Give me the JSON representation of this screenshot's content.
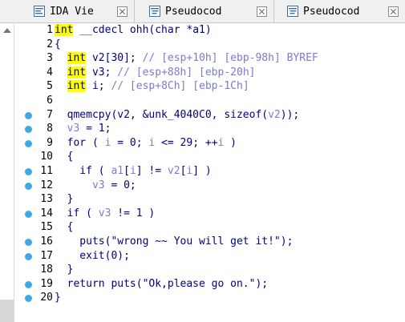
{
  "tabs": [
    {
      "label": "IDA Vie",
      "icon": "ida-view-icon"
    },
    {
      "label": "Pseudocod",
      "icon": "pseudocode-icon"
    },
    {
      "label": "Pseudocod",
      "icon": "pseudocode-icon"
    }
  ],
  "lines": [
    {
      "num": "1",
      "bp": false,
      "parts": [
        [
          "kw",
          "int"
        ],
        [
          "t",
          " __cdecl ohh(char *a1)"
        ]
      ]
    },
    {
      "num": "2",
      "bp": false,
      "parts": [
        [
          "t",
          "{"
        ]
      ]
    },
    {
      "num": "3",
      "bp": false,
      "parts": [
        [
          "t",
          "  "
        ],
        [
          "kw",
          "int"
        ],
        [
          "t",
          " v2[30]; "
        ],
        [
          "cm",
          "// [esp+10h] [ebp-98h] BYREF"
        ]
      ]
    },
    {
      "num": "4",
      "bp": false,
      "parts": [
        [
          "t",
          "  "
        ],
        [
          "kw",
          "int"
        ],
        [
          "t",
          " v3; "
        ],
        [
          "cm",
          "// [esp+88h] [ebp-20h]"
        ]
      ]
    },
    {
      "num": "5",
      "bp": false,
      "parts": [
        [
          "t",
          "  "
        ],
        [
          "kw",
          "int"
        ],
        [
          "t",
          " i; "
        ],
        [
          "cm",
          "// [esp+8Ch] [ebp-1Ch]"
        ]
      ]
    },
    {
      "num": "6",
      "bp": false,
      "parts": [
        [
          "t",
          ""
        ]
      ]
    },
    {
      "num": "7",
      "bp": true,
      "parts": [
        [
          "t",
          "  qmemcpy(v2, &unk_4040C0, sizeof("
        ],
        [
          "gv",
          "v2"
        ],
        [
          "t",
          "));"
        ]
      ]
    },
    {
      "num": "8",
      "bp": true,
      "parts": [
        [
          "t",
          "  "
        ],
        [
          "gv",
          "v3"
        ],
        [
          "t",
          " = 1;"
        ]
      ]
    },
    {
      "num": "9",
      "bp": true,
      "parts": [
        [
          "t",
          "  for ( "
        ],
        [
          "gv",
          "i"
        ],
        [
          "t",
          " = 0; "
        ],
        [
          "gv",
          "i"
        ],
        [
          "t",
          " <= 29; ++"
        ],
        [
          "gv",
          "i"
        ],
        [
          "t",
          " )"
        ]
      ]
    },
    {
      "num": "10",
      "bp": false,
      "parts": [
        [
          "t",
          "  {"
        ]
      ]
    },
    {
      "num": "11",
      "bp": true,
      "parts": [
        [
          "t",
          "    if ( "
        ],
        [
          "gv",
          "a1"
        ],
        [
          "t",
          "["
        ],
        [
          "gv",
          "i"
        ],
        [
          "t",
          "] != "
        ],
        [
          "gv",
          "v2"
        ],
        [
          "t",
          "["
        ],
        [
          "gv",
          "i"
        ],
        [
          "t",
          "] )"
        ]
      ]
    },
    {
      "num": "12",
      "bp": true,
      "parts": [
        [
          "t",
          "      "
        ],
        [
          "gv",
          "v3"
        ],
        [
          "t",
          " = 0;"
        ]
      ]
    },
    {
      "num": "13",
      "bp": false,
      "parts": [
        [
          "t",
          "  }"
        ]
      ]
    },
    {
      "num": "14",
      "bp": true,
      "parts": [
        [
          "t",
          "  if ( "
        ],
        [
          "gv",
          "v3"
        ],
        [
          "t",
          " != 1 )"
        ]
      ]
    },
    {
      "num": "15",
      "bp": false,
      "parts": [
        [
          "t",
          "  {"
        ]
      ]
    },
    {
      "num": "16",
      "bp": true,
      "parts": [
        [
          "t",
          "    puts(\"wrong ~~ You will get it!\");"
        ]
      ]
    },
    {
      "num": "17",
      "bp": true,
      "parts": [
        [
          "t",
          "    exit(0);"
        ]
      ]
    },
    {
      "num": "18",
      "bp": false,
      "parts": [
        [
          "t",
          "  }"
        ]
      ]
    },
    {
      "num": "19",
      "bp": true,
      "parts": [
        [
          "t",
          "  return puts(\"Ok,please go on.\");"
        ]
      ]
    },
    {
      "num": "20",
      "bp": true,
      "parts": [
        [
          "t",
          "}"
        ]
      ]
    }
  ],
  "colors": {
    "breakpoint": "#3fa9e8",
    "keyword_bg": "#ffff00",
    "code": "#000080",
    "comment": "#7b7bce"
  }
}
